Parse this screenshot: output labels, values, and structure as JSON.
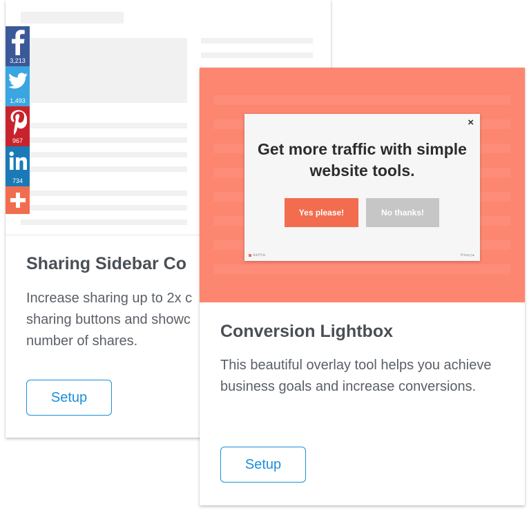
{
  "colors": {
    "facebook": "#3b5998",
    "twitter": "#3aa6e0",
    "pinterest": "#c8232c",
    "linkedin": "#1a7ab8",
    "more": "#f26d4f",
    "lightbox_overlay": "#fd8670",
    "setup_accent": "#1a8fd8",
    "yes_button": "#f26d4f",
    "no_button": "#c6c6c6"
  },
  "sharing_sidebar": {
    "buttons": [
      {
        "network": "facebook",
        "icon": "facebook-icon",
        "count": "3,213"
      },
      {
        "network": "twitter",
        "icon": "twitter-icon",
        "count": "1,493"
      },
      {
        "network": "pinterest",
        "icon": "pinterest-icon",
        "count": "967"
      },
      {
        "network": "linkedin",
        "icon": "linkedin-icon",
        "count": "734"
      },
      {
        "network": "more",
        "icon": "plus-icon"
      }
    ]
  },
  "card_sharing": {
    "title": "Sharing Sidebar Co",
    "description": "Increase sharing up to 2x c sharing buttons and showc number of shares.",
    "setup_label": "Setup"
  },
  "card_lightbox": {
    "title": "Conversion Lightbox",
    "description": "This beautiful overlay tool helps you achieve business goals and increase conversions.",
    "setup_label": "Setup",
    "lightbox": {
      "close_glyph": "×",
      "headline": "Get more traffic with simple website tools.",
      "yes_label": "Yes please!",
      "no_label": "No thanks!",
      "brand": "AddThis",
      "privacy": "Privacy",
      "privacy_glyph": "▸"
    }
  }
}
